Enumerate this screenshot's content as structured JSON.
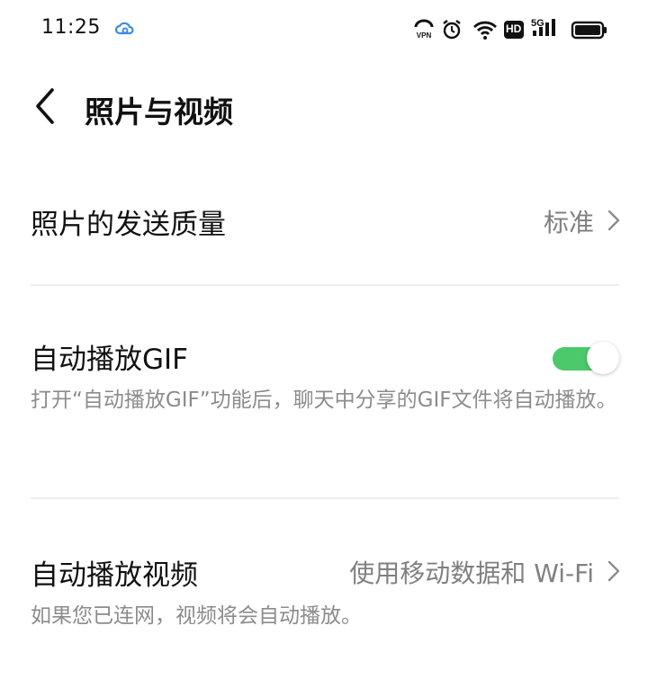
{
  "status_bar": {
    "time": "11:25",
    "cloud_icon": "cloud-sync-icon",
    "vpn_icon": "vpn-icon",
    "alarm_icon": "alarm-icon",
    "wifi_icon": "wifi-icon",
    "hd_badge": "HD",
    "signal_label": "5G",
    "battery_icon": "battery-icon"
  },
  "header": {
    "title": "照片与视频",
    "back_icon": "chevron-left-icon"
  },
  "settings": {
    "photo_quality": {
      "title": "照片的发送质量",
      "value": "标准"
    },
    "autoplay_gif": {
      "title": "自动播放GIF",
      "description": "打开“自动播放GIF”功能后，聊天中分享的GIF文件将自动播放。",
      "enabled": true
    },
    "autoplay_video": {
      "title": "自动播放视频",
      "value": "使用移动数据和 Wi-Fi",
      "description": "如果您已连网，视频将会自动播放。"
    }
  },
  "colors": {
    "toggle_on": "#4cc96b",
    "text_primary": "#111111",
    "text_secondary": "#8c8c8c",
    "cloud_blue": "#3b8de0"
  }
}
